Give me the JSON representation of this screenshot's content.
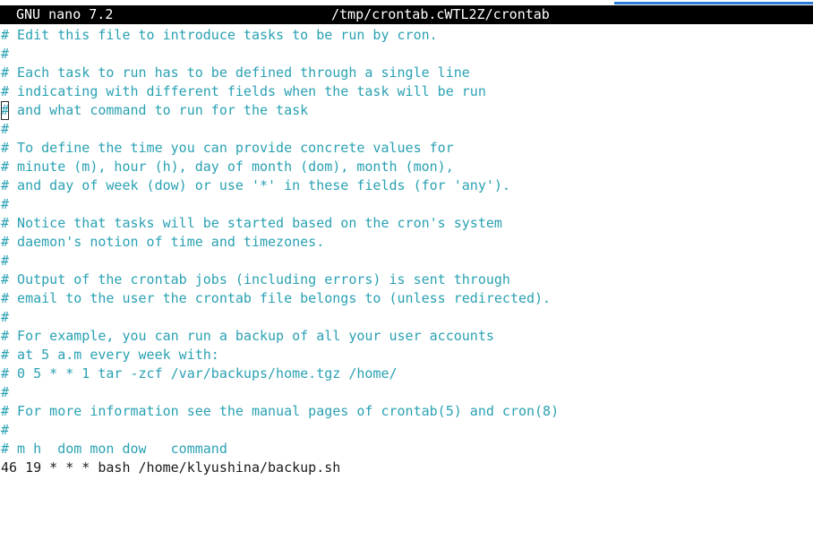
{
  "titlebar": {
    "app": "GNU nano 7.2",
    "file": "/tmp/crontab.cWTL2Z/crontab"
  },
  "colors": {
    "titlebar_bg": "#000000",
    "titlebar_fg": "#ffffff",
    "comment": "#2aa1b3",
    "code": "#1a1a1a",
    "accent": "#2c7bd6"
  },
  "editor": {
    "cursor_line": 5,
    "lines": [
      {
        "text": "# Edit this file to introduce tasks to be run by cron.",
        "kind": "comment"
      },
      {
        "text": "#",
        "kind": "comment"
      },
      {
        "text": "# Each task to run has to be defined through a single line",
        "kind": "comment"
      },
      {
        "text": "# indicating with different fields when the task will be run",
        "kind": "comment"
      },
      {
        "text": "# and what command to run for the task",
        "kind": "comment"
      },
      {
        "text": "#",
        "kind": "comment"
      },
      {
        "text": "# To define the time you can provide concrete values for",
        "kind": "comment"
      },
      {
        "text": "# minute (m), hour (h), day of month (dom), month (mon),",
        "kind": "comment"
      },
      {
        "text": "# and day of week (dow) or use '*' in these fields (for 'any').",
        "kind": "comment"
      },
      {
        "text": "#",
        "kind": "comment"
      },
      {
        "text": "# Notice that tasks will be started based on the cron's system",
        "kind": "comment"
      },
      {
        "text": "# daemon's notion of time and timezones.",
        "kind": "comment"
      },
      {
        "text": "#",
        "kind": "comment"
      },
      {
        "text": "# Output of the crontab jobs (including errors) is sent through",
        "kind": "comment"
      },
      {
        "text": "# email to the user the crontab file belongs to (unless redirected).",
        "kind": "comment"
      },
      {
        "text": "#",
        "kind": "comment"
      },
      {
        "text": "# For example, you can run a backup of all your user accounts",
        "kind": "comment"
      },
      {
        "text": "# at 5 a.m every week with:",
        "kind": "comment"
      },
      {
        "text": "# 0 5 * * 1 tar -zcf /var/backups/home.tgz /home/",
        "kind": "comment"
      },
      {
        "text": "#",
        "kind": "comment"
      },
      {
        "text": "# For more information see the manual pages of crontab(5) and cron(8)",
        "kind": "comment"
      },
      {
        "text": "#",
        "kind": "comment"
      },
      {
        "text": "# m h  dom mon dow   command",
        "kind": "comment"
      },
      {
        "text": "46 19 * * * bash /home/klyushina/backup.sh",
        "kind": "code"
      }
    ]
  }
}
